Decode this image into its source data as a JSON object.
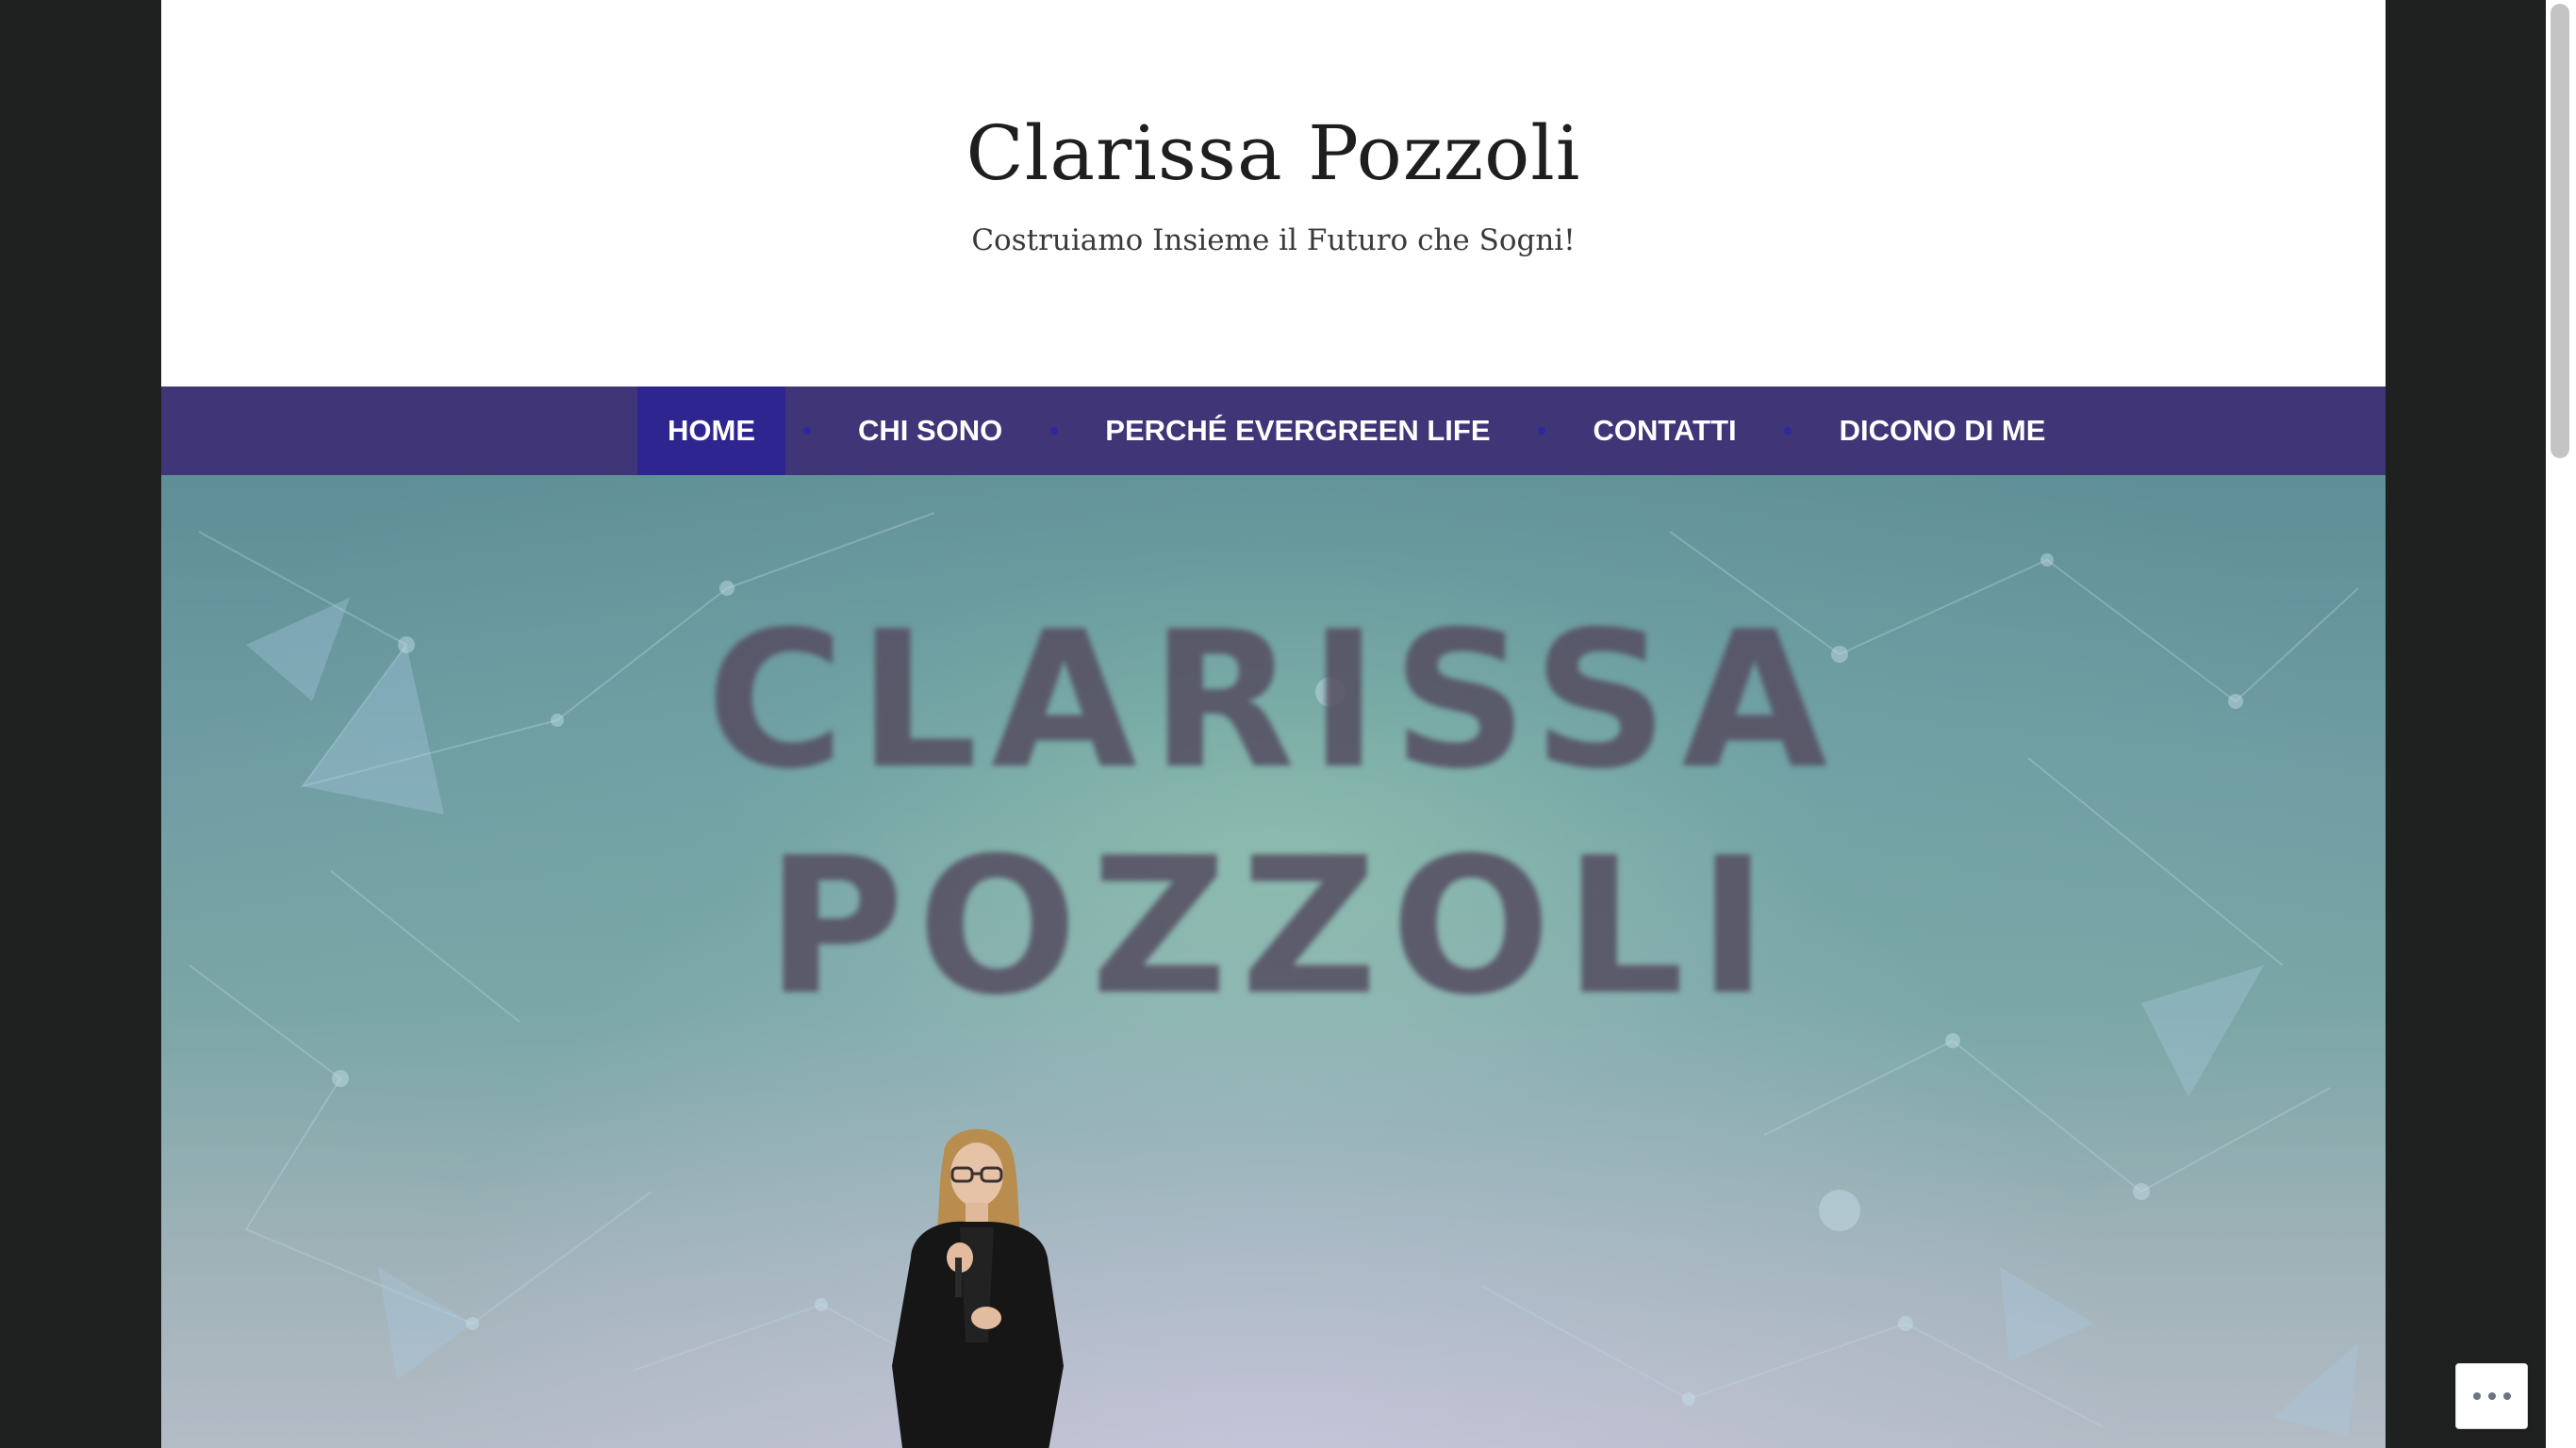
{
  "site": {
    "title": "Clarissa Pozzoli",
    "description": "Costruiamo Insieme il Futuro che Sogni!"
  },
  "nav": {
    "items": [
      {
        "label": "HOME",
        "active": true
      },
      {
        "label": "CHI SONO",
        "active": false
      },
      {
        "label": "PERCHÉ EVERGREEN LIFE",
        "active": false
      },
      {
        "label": "CONTATTI",
        "active": false
      },
      {
        "label": "DICONO DI ME",
        "active": false
      }
    ]
  },
  "hero": {
    "banner_line1": "CLARISSA",
    "banner_line2": "POZZOLI",
    "image": "speaker-on-stage-photo"
  },
  "floating": {
    "icon": "more-horizontal-icon"
  },
  "colors": {
    "nav_background": "#3f3577",
    "nav_active": "#2e2590",
    "page_background": "#1f2120",
    "title_text": "#1e1e1e"
  }
}
